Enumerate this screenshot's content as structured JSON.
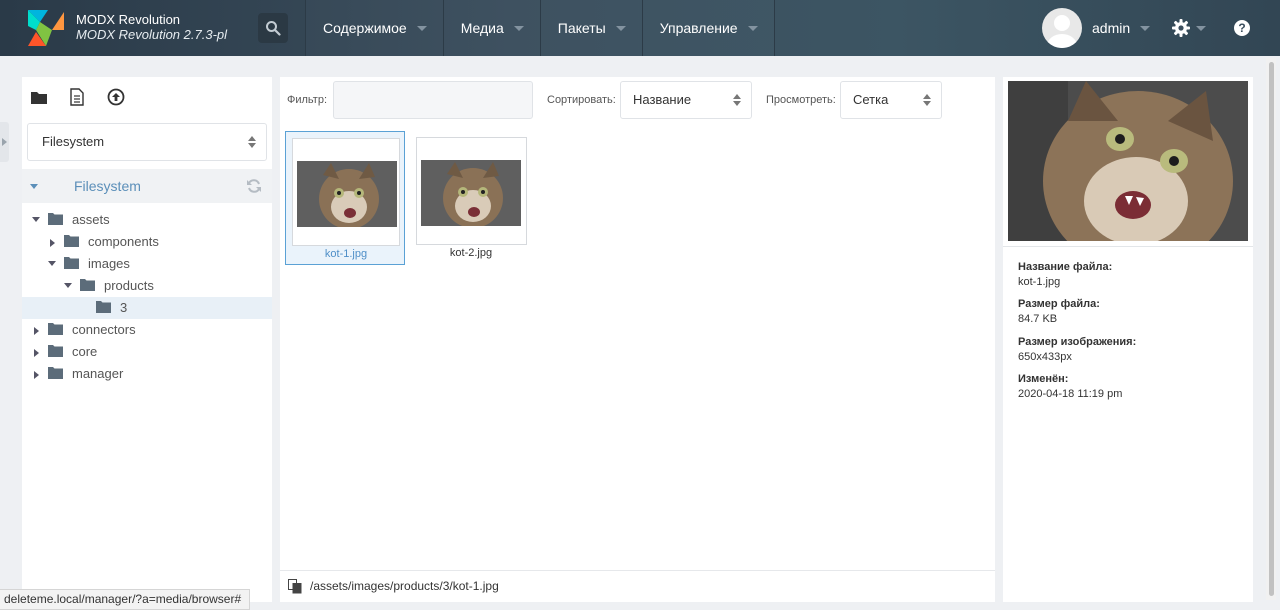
{
  "app": {
    "title": "MODX Revolution",
    "version": "MODX Revolution 2.7.3-pl"
  },
  "nav": {
    "items": [
      {
        "label": "Содержимое"
      },
      {
        "label": "Медиа"
      },
      {
        "label": "Пакеты"
      },
      {
        "label": "Управление"
      }
    ]
  },
  "user": {
    "name": "admin"
  },
  "help": {
    "label": "?"
  },
  "left": {
    "source_select": "Filesystem",
    "tree_head": "Filesystem",
    "tree": [
      {
        "label": "assets",
        "expanded": true
      },
      {
        "label": "components",
        "expanded": false
      },
      {
        "label": "images",
        "expanded": true
      },
      {
        "label": "products",
        "expanded": true
      },
      {
        "label": "3",
        "selected": true
      },
      {
        "label": "connectors",
        "expanded": false
      },
      {
        "label": "core",
        "expanded": false
      },
      {
        "label": "manager",
        "expanded": false
      }
    ]
  },
  "toolbar": {
    "filter_label": "Фильтр:",
    "filter_value": "",
    "sort_label": "Сортировать:",
    "sort_value": "Название",
    "view_label": "Просмотреть:",
    "view_value": "Сетка"
  },
  "files": [
    {
      "name": "kot-1.jpg",
      "selected": true
    },
    {
      "name": "kot-2.jpg",
      "selected": false
    }
  ],
  "path": "/assets/images/products/3/kot-1.jpg",
  "details": {
    "name_label": "Название файла:",
    "name_value": "kot-1.jpg",
    "size_label": "Размер файла:",
    "size_value": "84.7 KB",
    "dims_label": "Размер изображения:",
    "dims_value": "650x433px",
    "modified_label": "Изменён:",
    "modified_value": "2020-04-18 11:19 pm"
  },
  "status_url": "deleteme.local/manager/?a=media/browser#",
  "colors": {
    "topbar": "#3b4e5d",
    "accent": "#5b8fb9",
    "selection": "#5aa1d5"
  }
}
